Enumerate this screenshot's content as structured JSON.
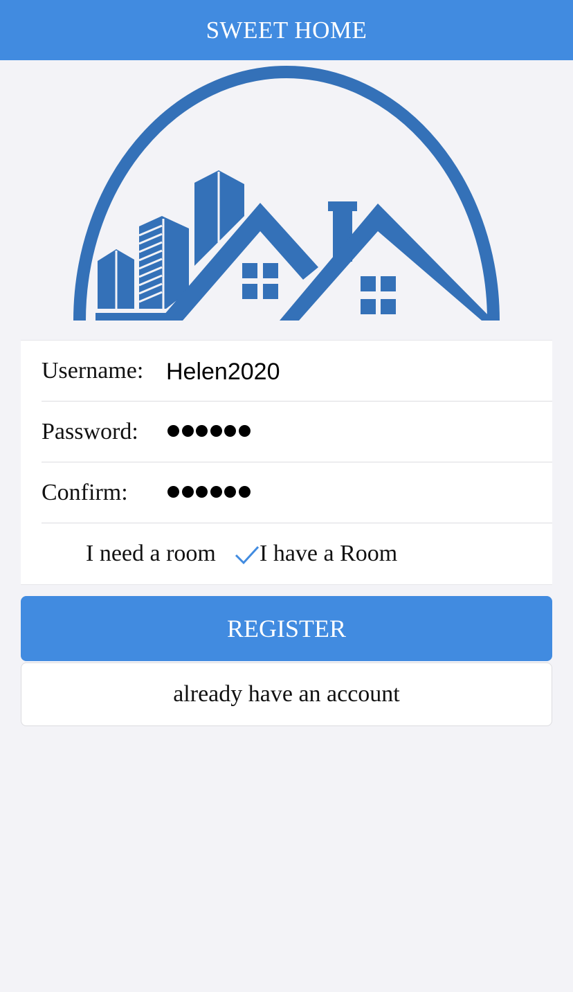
{
  "navbar": {
    "title": "SWEET HOME"
  },
  "logo": {
    "icon": "house-logo-icon",
    "color": "#3471b8"
  },
  "form": {
    "username": {
      "label": "Username:",
      "value": "Helen2020"
    },
    "password": {
      "label": "Password:",
      "masked_length": 6
    },
    "confirm": {
      "label": "Confirm:",
      "masked_length": 6
    },
    "room_options": [
      {
        "label": "I need a room",
        "selected": false
      },
      {
        "label": "I have a Room",
        "selected": true
      }
    ]
  },
  "buttons": {
    "register_label": "REGISTER",
    "account_label": "already have an account"
  },
  "colors": {
    "accent": "#418be0",
    "logo": "#3471b8",
    "background": "#f3f3f7",
    "check": "#418be0"
  }
}
